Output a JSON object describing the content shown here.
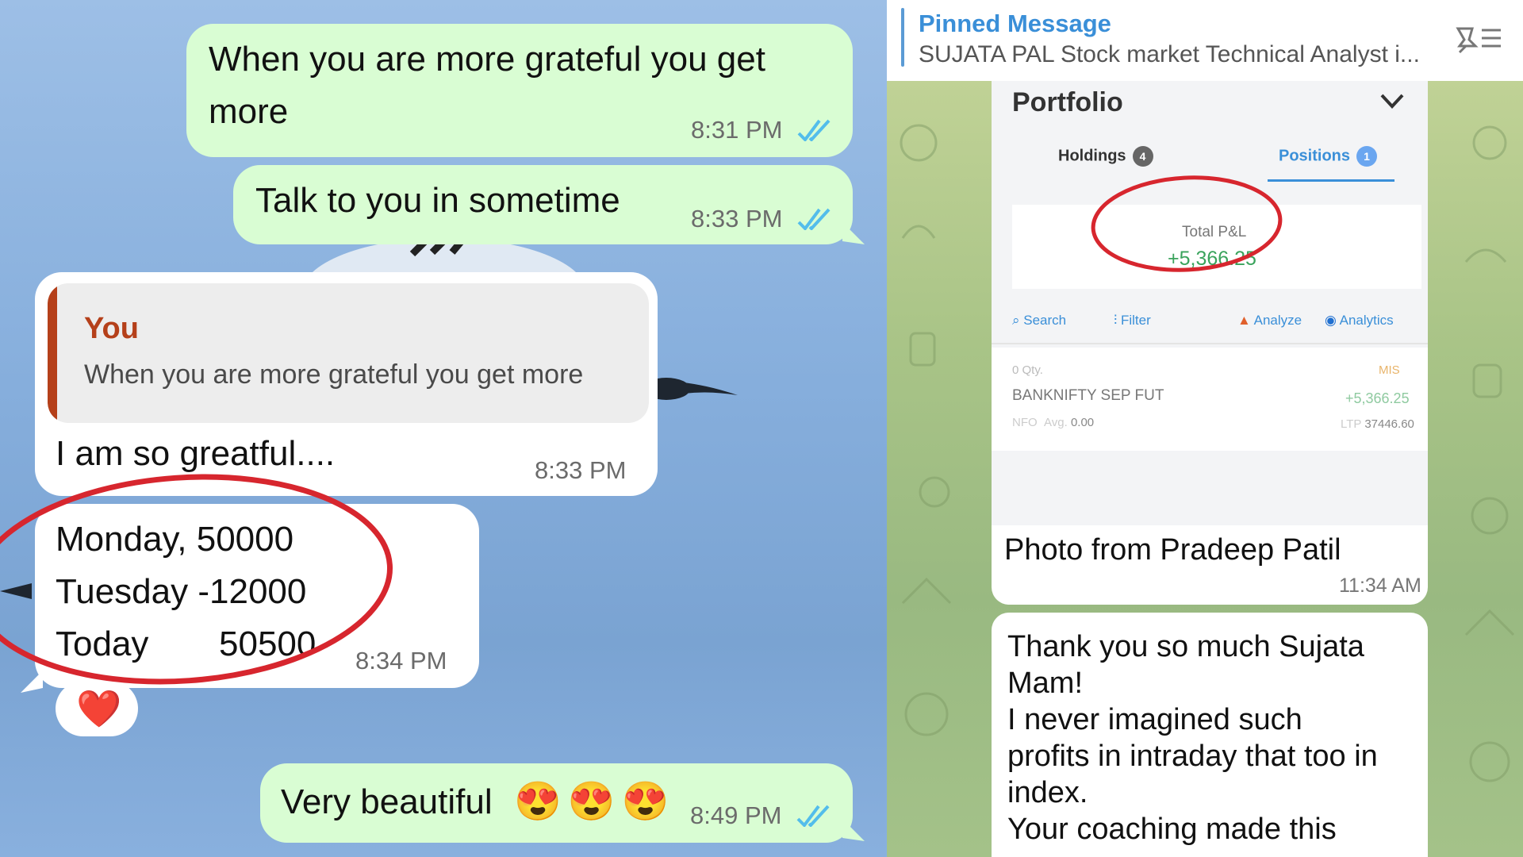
{
  "left_chat": {
    "messages": [
      {
        "text_line1": "When you are more grateful you get",
        "text_line2": "more",
        "time": "8:31 PM"
      },
      {
        "text": "Talk to you  in sometime",
        "time": "8:33 PM"
      },
      {
        "quote_author": "You",
        "quote_text": "When you are more grateful you get more",
        "text": "I am so greatful....",
        "time": "8:33 PM"
      },
      {
        "lines": [
          "Monday, 50000",
          "Tuesday -12000",
          "Today",
          "50500"
        ],
        "time": "8:34 PM",
        "reaction": "❤️"
      },
      {
        "text": "Very beautiful",
        "emojis": "😍😍😍",
        "time": "8:49 PM"
      }
    ]
  },
  "right_chat": {
    "pinned": {
      "title": "Pinned Message",
      "text": "SUJATA PAL Stock market Technical Analyst i..."
    },
    "portfolio": {
      "title": "Portfolio",
      "tabs": [
        {
          "label": "Holdings",
          "count": "4"
        },
        {
          "label": "Positions",
          "count": "1"
        }
      ],
      "pl_label": "Total P&L",
      "pl_value": "+5,366.25",
      "actions": [
        "Search",
        "Filter",
        "Analyze",
        "Analytics"
      ],
      "position": {
        "qty": "0 Qty.",
        "product": "MIS",
        "symbol": "BANKNIFTY SEP FUT",
        "pnl": "+5,366.25",
        "exchange": "NFO",
        "avg_label": "Avg.",
        "avg": "0.00",
        "ltp_label": "LTP",
        "ltp": "37446.60"
      }
    },
    "photo_caption": "Photo from Pradeep Patil",
    "photo_time": "11:34 AM",
    "thanks_lines": [
      "Thank you so much Sujata",
      "Mam!",
      "I never imagined such",
      "profits in intraday that too in",
      "index.",
      "Your coaching made this"
    ]
  },
  "colors": {
    "accent_red": "#d7262e",
    "tick_blue": "#53bdeb",
    "bubble_green": "#d9fdd3",
    "profit_green": "#3aa35c"
  }
}
